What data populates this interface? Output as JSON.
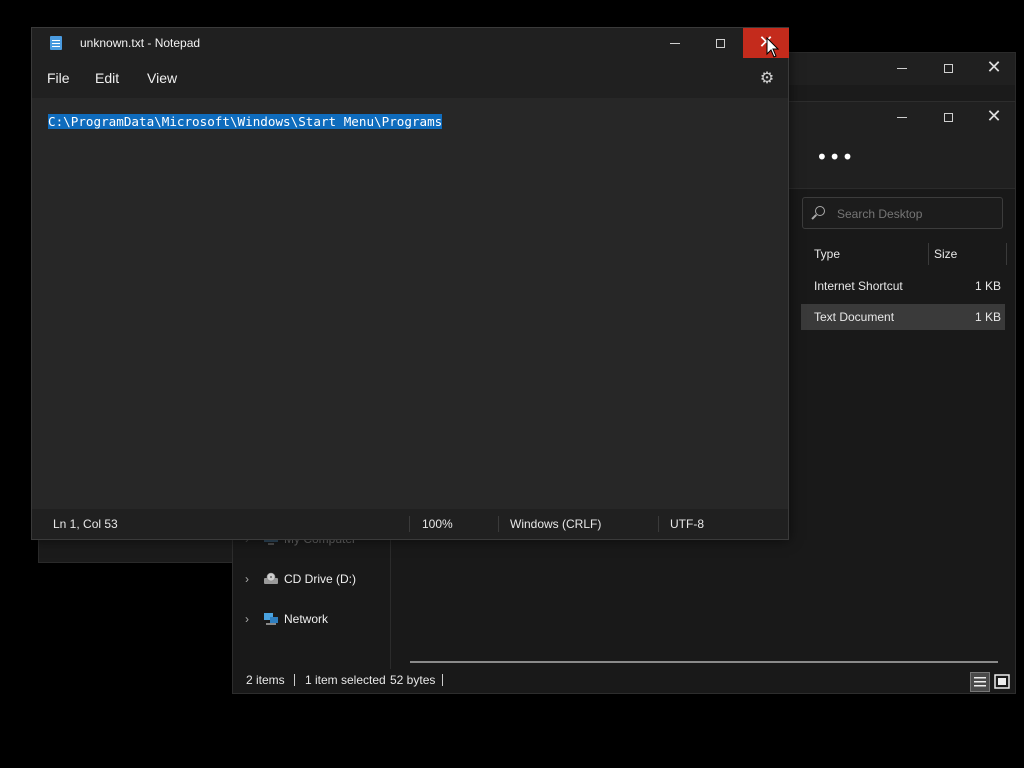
{
  "notepad": {
    "title": "unknown.txt - Notepad",
    "menu": [
      "File",
      "Edit",
      "View"
    ],
    "content": "C:\\ProgramData\\Microsoft\\Windows\\Start Menu\\Programs",
    "status": {
      "position": "Ln 1, Col 53",
      "zoom": "100%",
      "line_endings": "Windows (CRLF)",
      "encoding": "UTF-8"
    }
  },
  "explorer": {
    "search_placeholder": "Search Desktop",
    "columns": {
      "type": "Type",
      "size": "Size"
    },
    "files": [
      {
        "type": "Internet Shortcut",
        "size": "1 KB"
      },
      {
        "type": "Text Document",
        "size": "1 KB",
        "selected": true
      }
    ],
    "nav": [
      {
        "label": "My Computer"
      },
      {
        "label": "CD Drive (D:)"
      },
      {
        "label": "Network"
      }
    ],
    "status": {
      "items": "2 items",
      "selected": "1 item selected",
      "size": "52 bytes"
    }
  },
  "colors": {
    "accent_close": "#c42b1c",
    "selection": "#0f6cbd",
    "background": "#000000"
  }
}
